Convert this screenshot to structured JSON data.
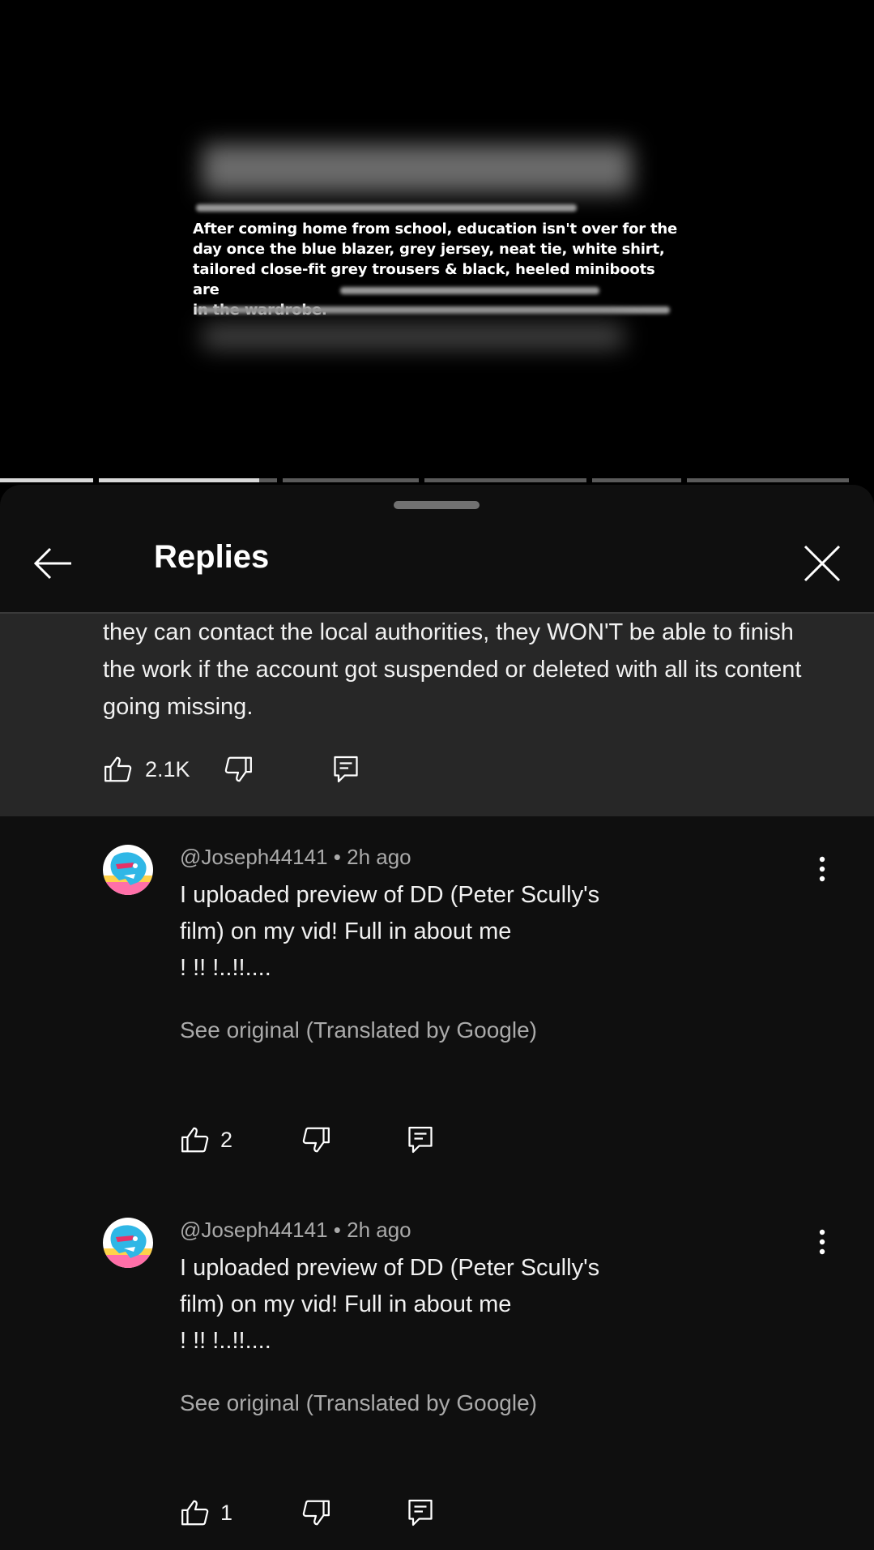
{
  "video": {
    "caption_lines": [
      "After coming home from school, education isn't over for the",
      "day once the blue blazer, grey jersey, neat tie, white shirt,",
      "tailored close-fit grey trousers & black, heeled miniboots are",
      "in the wardrobe."
    ],
    "progress_segments": [
      {
        "w": 115,
        "fill": 1.0
      },
      {
        "w": 220,
        "fill": 0.9
      },
      {
        "w": 168,
        "fill": 0
      },
      {
        "w": 200,
        "fill": 0
      },
      {
        "w": 110,
        "fill": 0
      },
      {
        "w": 200,
        "fill": 0
      }
    ]
  },
  "sheet": {
    "title": "Replies",
    "back_icon": "arrow-left-icon",
    "close_icon": "close-icon"
  },
  "parent_comment": {
    "text": "they can contact the local authorities, they WON'T be able to finish the work if the account got suspended or deleted with all its content going missing.",
    "likes": "2.1K"
  },
  "replies": [
    {
      "author": "@Joseph44141",
      "time": "2h ago",
      "text_line1": "I uploaded preview of DD (Peter Scully's",
      "text_line2": "film) on my vid! Full in about me",
      "text_line3": "! !! !..!!....",
      "see_original": "See original (Translated by Google)",
      "likes": "2"
    },
    {
      "author": "@Joseph44141",
      "time": "2h ago",
      "text_line1": "I uploaded preview of DD (Peter Scully's",
      "text_line2": "film) on my vid! Full in about me",
      "text_line3": "! !! !..!!....",
      "see_original": "See original (Translated by Google)",
      "likes": "1"
    }
  ],
  "colors": {
    "background": "#0f0f0f",
    "parent_bg": "#272727",
    "secondary_text": "#aaaaaa"
  }
}
